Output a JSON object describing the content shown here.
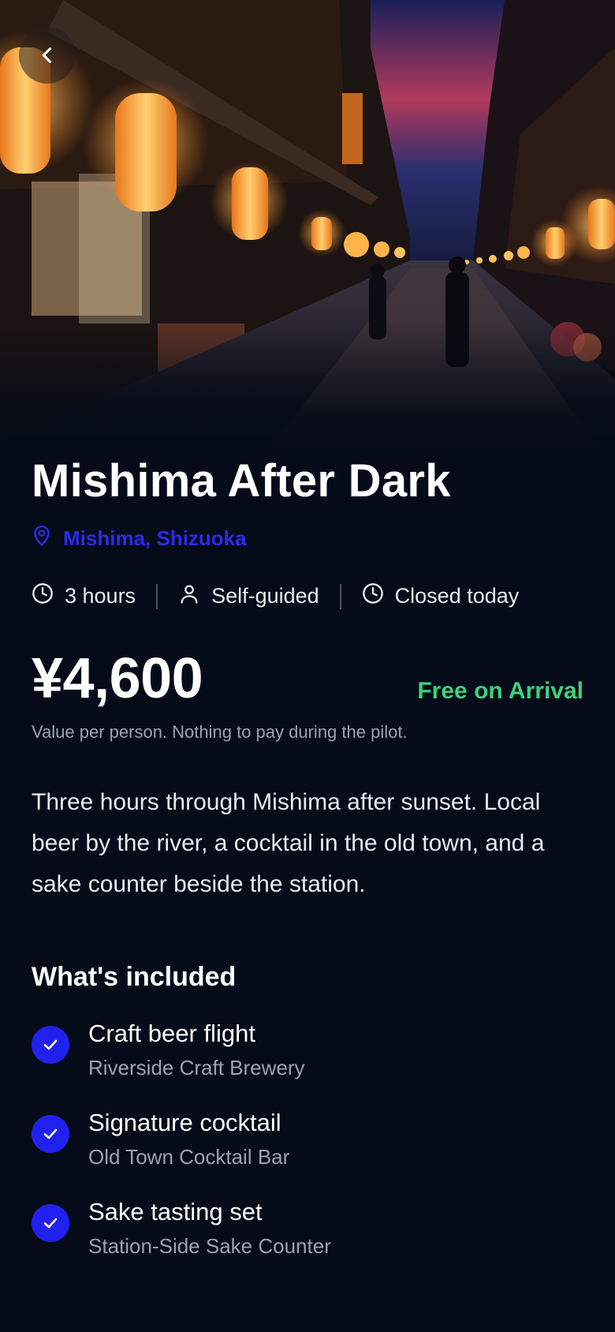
{
  "hero": {
    "back_icon": "chevron-left-icon"
  },
  "experience": {
    "title": "Mishima After Dark",
    "location": "Mishima, Shizuoka",
    "location_icon": "map-pin-icon"
  },
  "meta": {
    "duration": "3 hours",
    "guide": "Self-guided",
    "status": "Closed today"
  },
  "pricing": {
    "price": "¥4,600",
    "badge": "Free on Arrival",
    "note": "Value per person. Nothing to pay during the pilot."
  },
  "description": "Three hours through Mishima after sunset. Local beer by the river, a cocktail in the old town, and a sake counter beside the station.",
  "included": {
    "title": "What's included",
    "items": [
      {
        "name": "Craft beer flight",
        "venue": "Riverside Craft Brewery"
      },
      {
        "name": "Signature cocktail",
        "venue": "Old Town Cocktail Bar"
      },
      {
        "name": "Sake tasting set",
        "venue": "Station-Side Sake Counter"
      }
    ]
  },
  "colors": {
    "background": "#050b18",
    "accent": "#2121ef",
    "success": "#3dd17a",
    "muted": "#9aa3b5"
  }
}
